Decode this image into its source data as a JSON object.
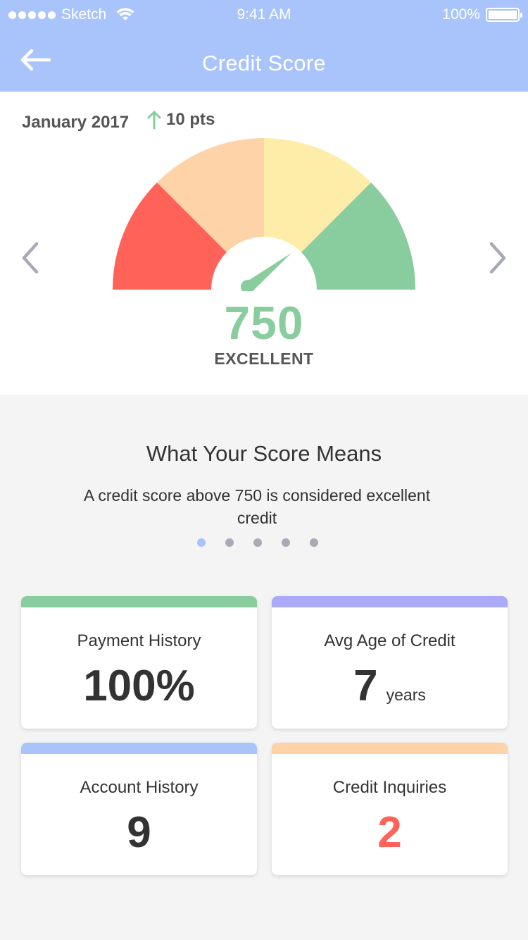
{
  "status_bar": {
    "carrier": "Sketch",
    "time": "9:41 AM",
    "battery": "100%"
  },
  "header": {
    "title": "Credit Score"
  },
  "score": {
    "month": "January 2017",
    "change": "10 pts",
    "value": "750",
    "rating": "EXCELLENT",
    "gauge_segments": [
      "#ff6259",
      "#fed3a7",
      "#feeda8",
      "#89cc9d"
    ]
  },
  "info": {
    "title": "What Your Score Means",
    "description": "A credit score above 750 is considered excellent credit",
    "pages": 5,
    "active_page": 1
  },
  "cards": [
    {
      "title": "Payment History",
      "value": "100%",
      "unit": "",
      "accent": "#89cc9d",
      "value_color": "#333333"
    },
    {
      "title": "Avg Age of Credit",
      "value": "7",
      "unit": "years",
      "accent": "#aaaaf9",
      "value_color": "#333333"
    },
    {
      "title": "Account History",
      "value": "9",
      "unit": "",
      "accent": "#a9c4fb",
      "value_color": "#333333"
    },
    {
      "title": "Credit Inquiries",
      "value": "2",
      "unit": "",
      "accent": "#fed3a7",
      "value_color": "#ff6259"
    }
  ],
  "colors": {
    "header_bg": "#a9c4fb",
    "score_green": "#89cc9d",
    "arrow_gray": "#a8abb5"
  },
  "icons": {
    "back": "arrow-left-icon",
    "prev": "chevron-left-icon",
    "next": "chevron-right-icon",
    "trend": "arrow-up-icon"
  }
}
